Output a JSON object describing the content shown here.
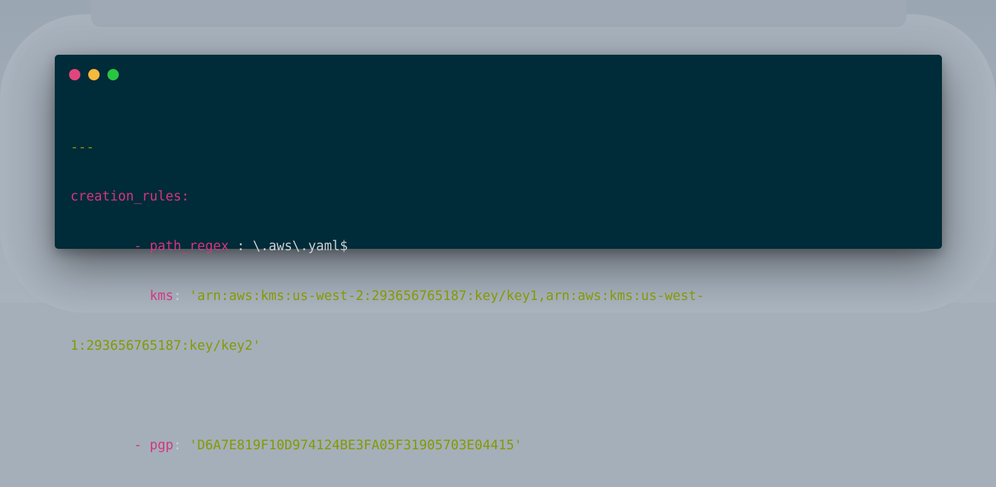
{
  "window": {
    "controls": [
      {
        "name": "close-button",
        "color": "#e0467c"
      },
      {
        "name": "minimize-button",
        "color": "#f7b93e"
      },
      {
        "name": "maximize-button",
        "color": "#29c540"
      }
    ]
  },
  "code": {
    "line1": {
      "separator": "---"
    },
    "line2": {
      "key": "creation_rules:"
    },
    "line3": {
      "indent": "        ",
      "dash": "- ",
      "key": "path_regex",
      "sep": " : ",
      "value": "\\.aws\\.yaml$"
    },
    "line4": {
      "indent": "          ",
      "key": "kms",
      "sep": ": ",
      "value": "'arn:aws:kms:us-west-2:293656765187:key/key1,arn:aws:kms:us-west-"
    },
    "line5": {
      "value": "1:293656765187:key/key2'"
    },
    "line6": {
      "value": ""
    },
    "line7": {
      "indent": "        ",
      "dash": "- ",
      "key": "pgp",
      "sep": ": ",
      "value": "'D6A7E819F10D974124BE3FA05F31905703E04415'"
    }
  },
  "colors": {
    "background": "#002b38",
    "key": "#d33682",
    "string": "#859900",
    "plain": "#c9d1d6"
  }
}
